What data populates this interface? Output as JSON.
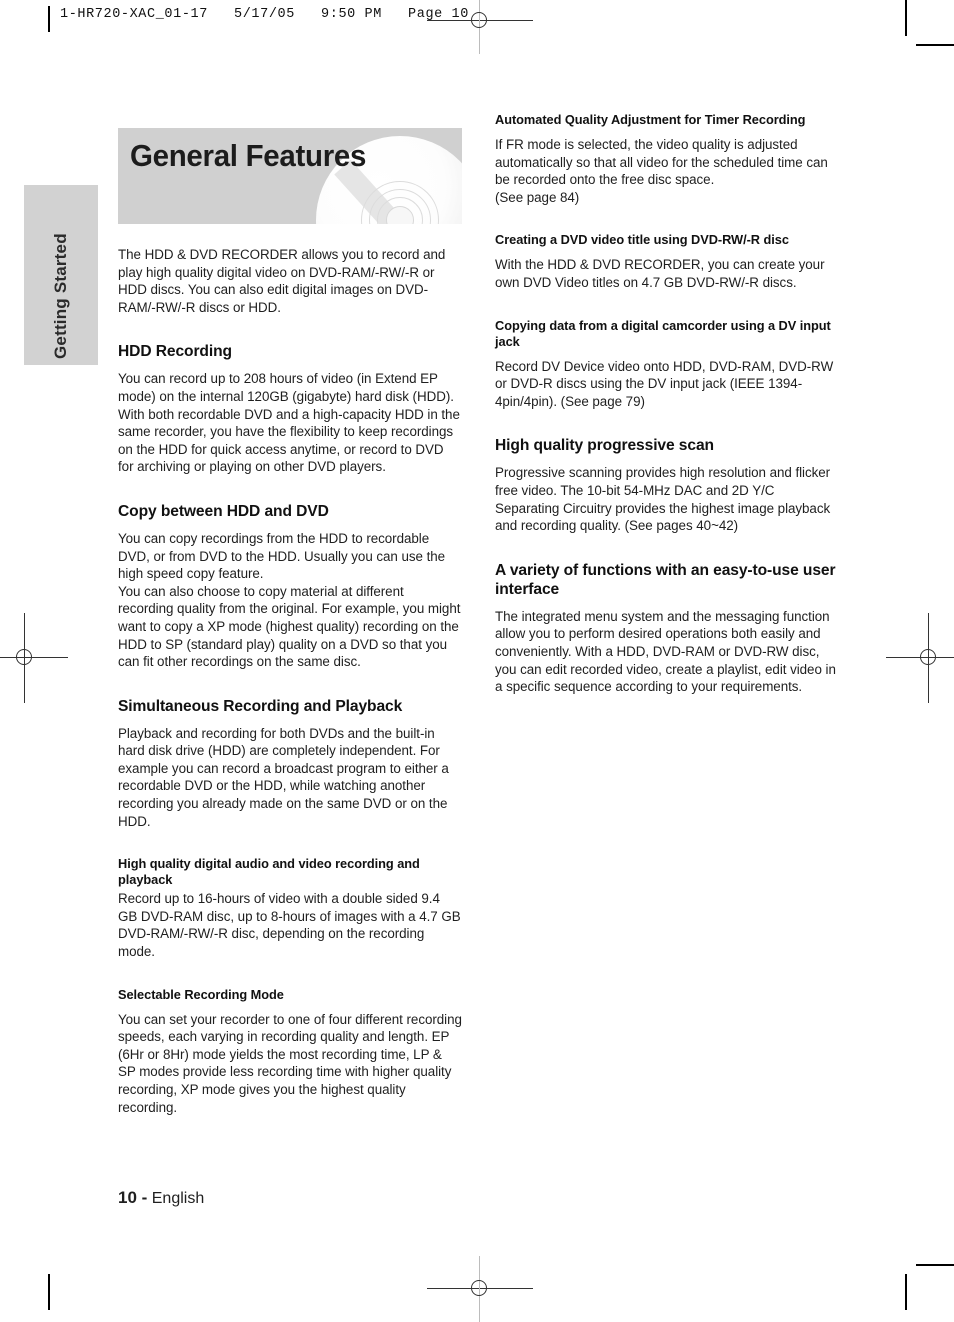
{
  "header": {
    "meta": "1-HR720-XAC_01-17   5/17/05   9:50 PM   Page 10"
  },
  "side_tab": {
    "label": "Getting Started"
  },
  "banner": {
    "title": "General Features",
    "graphic": "dvd-disc-icon"
  },
  "left_column": {
    "intro": "The HDD & DVD RECORDER allows you to record and play high quality digital video on DVD-RAM/-RW/-R or HDD discs. You can also edit digital images on DVD-RAM/-RW/-R discs or HDD.",
    "sections": [
      {
        "heading": "HDD Recording",
        "heading_level": "major",
        "body": "You can record up to 208 hours of video (in Extend EP mode) on the internal 120GB (gigabyte) hard disk (HDD). With both recordable DVD and a high-capacity HDD in the same recorder, you have the flexibility to keep recordings on the HDD for quick access anytime, or record to DVD for archiving or playing on other DVD players."
      },
      {
        "heading": "Copy between HDD and DVD",
        "heading_level": "major",
        "body": "You can copy recordings from the HDD to recordable DVD, or from DVD to the HDD. Usually you can use the high speed copy feature.\nYou can also choose to copy material at different recording quality from the original. For example, you might want to copy a XP mode (highest quality) recording on the HDD to SP (standard play) quality on a DVD so that you can fit other recordings on the same disc."
      },
      {
        "heading": "Simultaneous Recording and Playback",
        "heading_level": "major",
        "body": "Playback and recording for both DVDs and the built-in hard disk drive (HDD) are completely independent. For example you can record a broadcast program to either a recordable DVD or the HDD, while watching another recording you already made on the same DVD or on the HDD."
      },
      {
        "heading": "High quality digital audio and video recording and playback",
        "heading_level": "minor",
        "body": "Record up to 16-hours of video with a double sided 9.4 GB DVD-RAM disc, up to 8-hours of images with a 4.7 GB DVD-RAM/-RW/-R disc, depending on the recording mode."
      },
      {
        "heading": "Selectable Recording Mode",
        "heading_level": "minor",
        "body": "You can set your recorder to one of four different recording speeds, each varying in recording quality and length. EP (6Hr or 8Hr) mode yields the most recording time, LP & SP modes provide less recording time with higher quality recording, XP mode gives you the highest quality recording."
      }
    ]
  },
  "right_column": {
    "sections": [
      {
        "heading": "Automated Quality Adjustment for Timer Recording",
        "heading_level": "minor",
        "body": "If FR mode is selected, the video quality is adjusted automatically so that all video for the scheduled time can be recorded onto the free disc space.\n(See page 84)"
      },
      {
        "heading": "Creating a DVD video title using DVD-RW/-R disc",
        "heading_level": "minor",
        "body": "With the HDD & DVD RECORDER, you can create your own DVD Video titles on 4.7 GB DVD-RW/-R discs."
      },
      {
        "heading": "Copying data from a digital camcorder using a DV input jack",
        "heading_level": "minor",
        "body": "Record DV Device video onto HDD, DVD-RAM, DVD-RW or DVD-R discs using the DV input jack (IEEE 1394-4pin/4pin). (See page 79)"
      },
      {
        "heading": "High quality progressive scan",
        "heading_level": "major",
        "body": "Progressive scanning provides high resolution and flicker free video. The 10-bit 54-MHz DAC and 2D Y/C Separating Circuitry provides the highest image playback and recording quality. (See pages 40~42)"
      },
      {
        "heading": "A variety of functions with an easy-to-use user interface",
        "heading_level": "major",
        "body": "The integrated menu system and the messaging function allow you to perform desired operations both easily and conveniently. With a HDD, DVD-RAM or DVD-RW disc, you can edit recorded video, create a playlist, edit video in a specific sequence according to your requirements."
      }
    ]
  },
  "footer": {
    "page_number": "10 -",
    "language": "English"
  }
}
